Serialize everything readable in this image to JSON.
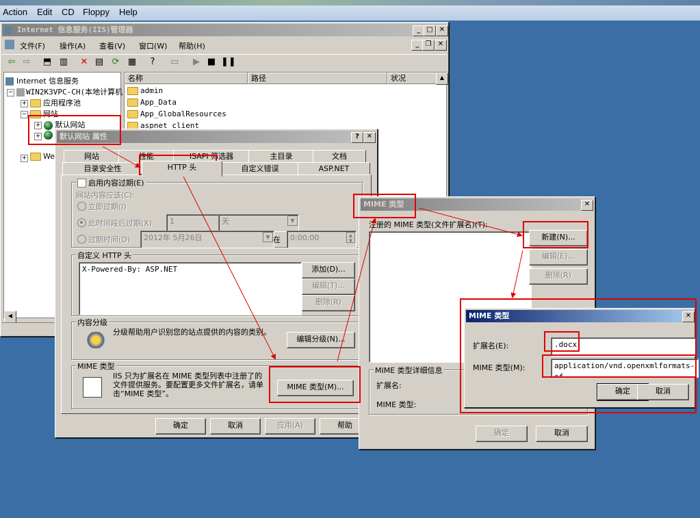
{
  "host_menu": [
    "Action",
    "Edit",
    "CD",
    "Floppy",
    "Help"
  ],
  "iis": {
    "title": "Internet 信息服务(IIS)管理器",
    "menu": [
      "文件(F)",
      "操作(A)",
      "查看(V)",
      "窗口(W)",
      "帮助(H)"
    ],
    "tree": {
      "root": "Internet 信息服务",
      "server": "WIN2K3VPC-CH(本地计算机",
      "app_pools": "应用程序池",
      "websites": "网站",
      "default_site": "默认网站",
      "web_ext": "Web"
    },
    "columns": [
      "名称",
      "路径",
      "状况"
    ],
    "files": [
      "admin",
      "App_Data",
      "App_GlobalResources",
      "aspnet_client"
    ]
  },
  "props": {
    "title": "默认网站 属性",
    "tabs_row1": [
      "网站",
      "性能",
      "ISAPI 筛选器",
      "主目录",
      "文档"
    ],
    "tabs_row2": [
      "目录安全性",
      "HTTP 头",
      "自定义错误",
      "ASP.NET"
    ],
    "expire_group": "启用内容过期(E)",
    "expire_label": "网站内容应该(C):",
    "opt_immediate": "立即过期(I)",
    "opt_after": "此时间段后过期(X)",
    "after_value": "1",
    "after_unit": "天",
    "opt_on": "过期时间(O)",
    "on_date": "2012年 5月26日",
    "on_sep": "在",
    "on_time": "0:00:00",
    "custom_group": "自定义 HTTP 头",
    "custom_value": "X-Powered-By: ASP.NET",
    "btn_add": "添加(D)...",
    "btn_edit": "编辑(T)...",
    "btn_delete": "删除(R)",
    "rating_group": "内容分级",
    "rating_text": "分级帮助用户识别您的站点提供的内容的类别。",
    "btn_rating": "编辑分级(N)...",
    "mime_group": "MIME 类型",
    "mime_text": "IIS 只为扩展名在 MIME 类型列表中注册了的文件提供服务。要配置更多文件扩展名，请单击“MIME 类型”。",
    "btn_mime": "MIME 类型(M)...",
    "btn_ok": "确定",
    "btn_cancel": "取消",
    "btn_apply": "应用(A)",
    "btn_help": "帮助"
  },
  "mime": {
    "title": "MIME 类型",
    "registered_label": "注册的 MIME 类型(文件扩展名)(T):",
    "btn_new": "新建(N)...",
    "btn_edit": "编辑(E)...",
    "btn_delete": "删除(R)",
    "details_group": "MIME 类型详细信息",
    "ext_label": "扩展名:",
    "type_label": "MIME 类型:",
    "btn_ok": "确定",
    "btn_cancel": "取消"
  },
  "mime_new": {
    "title": "MIME 类型",
    "ext_label": "扩展名(E):",
    "ext_value": ".docx",
    "type_label": "MIME 类型(M):",
    "type_value": "application/vnd.openxmlformats-of",
    "btn_ok": "确定",
    "btn_cancel": "取消"
  },
  "colors": {
    "accent": "#0a246a",
    "highlight": "#e00000",
    "desktop": "#3a6ea5",
    "face": "#d4d0c8"
  }
}
